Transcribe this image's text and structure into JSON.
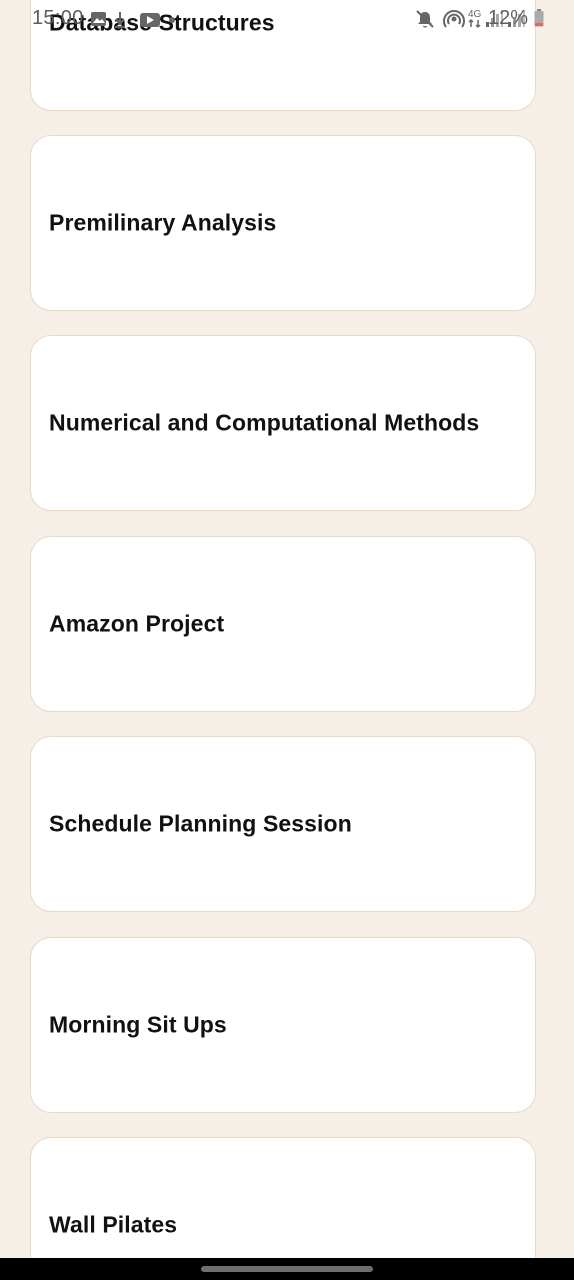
{
  "status_bar": {
    "time": "15:00",
    "battery_percent": "12%",
    "network": "4G"
  },
  "tasks": [
    {
      "title": "Database Structures"
    },
    {
      "title": "Premilinary Analysis"
    },
    {
      "title": "Numerical and Computational Methods"
    },
    {
      "title": "Amazon Project"
    },
    {
      "title": "Schedule Planning Session"
    },
    {
      "title": "Morning Sit Ups"
    },
    {
      "title": "Wall Pilates"
    }
  ],
  "colors": {
    "background": "#f6efe8",
    "card_border": "#ebd9c4",
    "card_background": "#ffffff",
    "title_text": "#111111",
    "battery_low": "#e06b5a"
  },
  "icons": {
    "status_left": [
      "image-icon",
      "download-icon",
      "youtube-icon",
      "dot-icon"
    ],
    "status_right": [
      "mute-icon",
      "hotspot-icon",
      "network-4g-icon",
      "signal-icon",
      "signal-icon",
      "battery-icon"
    ]
  }
}
